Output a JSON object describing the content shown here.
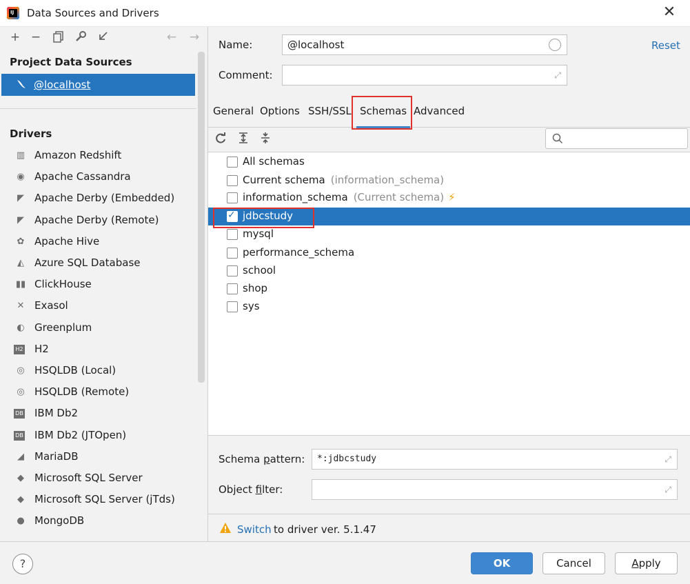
{
  "window": {
    "title": "Data Sources and Drivers",
    "close": "✕"
  },
  "left": {
    "project_header": "Project Data Sources",
    "selected_source": "@localhost",
    "drivers_header": "Drivers",
    "drivers": [
      {
        "label": "Amazon Redshift",
        "icon": "redshift-icon"
      },
      {
        "label": "Apache Cassandra",
        "icon": "cassandra-icon"
      },
      {
        "label": "Apache Derby (Embedded)",
        "icon": "derby-icon"
      },
      {
        "label": "Apache Derby (Remote)",
        "icon": "derby-icon"
      },
      {
        "label": "Apache Hive",
        "icon": "hive-icon"
      },
      {
        "label": "Azure SQL Database",
        "icon": "azure-icon"
      },
      {
        "label": "ClickHouse",
        "icon": "clickhouse-icon"
      },
      {
        "label": "Exasol",
        "icon": "exasol-icon"
      },
      {
        "label": "Greenplum",
        "icon": "greenplum-icon"
      },
      {
        "label": "H2",
        "icon": "h2-icon"
      },
      {
        "label": "HSQLDB (Local)",
        "icon": "hsqldb-icon"
      },
      {
        "label": "HSQLDB (Remote)",
        "icon": "hsqldb-icon"
      },
      {
        "label": "IBM Db2",
        "icon": "db2-icon"
      },
      {
        "label": "IBM Db2 (JTOpen)",
        "icon": "db2-icon"
      },
      {
        "label": "MariaDB",
        "icon": "mariadb-icon"
      },
      {
        "label": "Microsoft SQL Server",
        "icon": "mssql-icon"
      },
      {
        "label": "Microsoft SQL Server (jTds)",
        "icon": "mssql-icon"
      },
      {
        "label": "MongoDB",
        "icon": "mongodb-icon"
      }
    ]
  },
  "form": {
    "name_label": "Name:",
    "name_value": "@localhost",
    "comment_label": "Comment:",
    "comment_value": "",
    "reset": "Reset"
  },
  "tabs": [
    "General",
    "Options",
    "SSH/SSL",
    "Schemas",
    "Advanced"
  ],
  "active_tab": "Schemas",
  "schemas": [
    {
      "name": "All schemas",
      "note": "",
      "checked": false
    },
    {
      "name": "Current schema",
      "note": "(information_schema)",
      "checked": false
    },
    {
      "name": "information_schema",
      "note": "(Current schema)",
      "checked": false,
      "bolt": true
    },
    {
      "name": "jdbcstudy",
      "note": "",
      "checked": true,
      "selected": true
    },
    {
      "name": "mysql",
      "note": "",
      "checked": false
    },
    {
      "name": "performance_schema",
      "note": "",
      "checked": false
    },
    {
      "name": "school",
      "note": "",
      "checked": false
    },
    {
      "name": "shop",
      "note": "",
      "checked": false
    },
    {
      "name": "sys",
      "note": "",
      "checked": false
    }
  ],
  "filters": {
    "schema_pattern_label": "Schema pattern:",
    "schema_pattern_value": "*:jdbcstudy",
    "object_filter_label": "Object filter:",
    "object_filter_value": ""
  },
  "notice": {
    "link": "Switch",
    "text": "to driver ver. 5.1.47"
  },
  "buttons": {
    "help": "?",
    "ok": "OK",
    "cancel": "Cancel",
    "apply": "Apply"
  },
  "colors": {
    "accent": "#2675bf",
    "highlight_box": "#e0312a",
    "link": "#2470b3",
    "warning": "#f0a30a"
  }
}
